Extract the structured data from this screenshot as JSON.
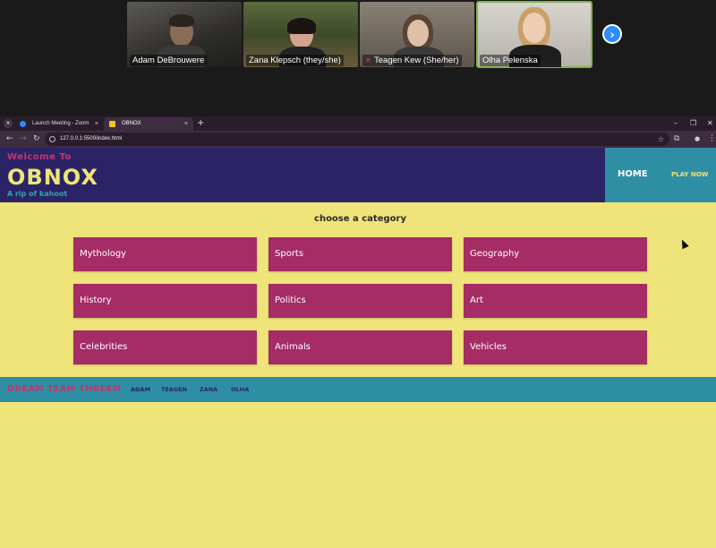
{
  "zoom": {
    "participants": [
      {
        "name": "Adam DeBrouwere",
        "muted": false,
        "active": false
      },
      {
        "name": "Zana Klepsch (they/she)",
        "muted": false,
        "active": false
      },
      {
        "name": "Teagen Kew (She/her)",
        "muted": true,
        "active": false
      },
      {
        "name": "Olha Pelenska",
        "muted": false,
        "active": true
      }
    ],
    "next_icon": "chevron-right-icon",
    "next_glyph": "›"
  },
  "browser": {
    "tabs": [
      {
        "title": "Launch Meeting - Zoom",
        "active": false,
        "favicon_color": "#2d8cff"
      },
      {
        "title": "OBNOX",
        "active": true,
        "favicon_color": "#f5c518"
      }
    ],
    "url": "127.0.0.1:5500/index.html",
    "glyphs": {
      "back": "←",
      "forward": "→",
      "reload": "↻",
      "star": "☆",
      "new_tab": "+",
      "close": "×",
      "minimize": "–",
      "restore": "❐",
      "window_close": "✕",
      "extensions": "⧉",
      "profile": "●",
      "menu": "⋮",
      "tab_list": "▾"
    }
  },
  "site": {
    "welcome": "Welcome To",
    "logo": "OBNOX",
    "tagline": "A rip of kahoot",
    "nav": {
      "home": "HOME",
      "play": "PLAY NOW"
    },
    "category_heading": "choose a category",
    "categories": [
      "Mythology",
      "Sports",
      "Geography",
      "History",
      "Politics",
      "Art",
      "Celebrities",
      "Animals",
      "Vehicles"
    ],
    "footer": {
      "team": "DREAM TEAM THREEM",
      "members": [
        "ADAM",
        "TEAGEN",
        "ZANA",
        "OLHA"
      ]
    },
    "colors": {
      "header": "#2a2466",
      "accent": "#a52c65",
      "teal": "#2e8fa4",
      "yellow": "#efe47a"
    }
  }
}
